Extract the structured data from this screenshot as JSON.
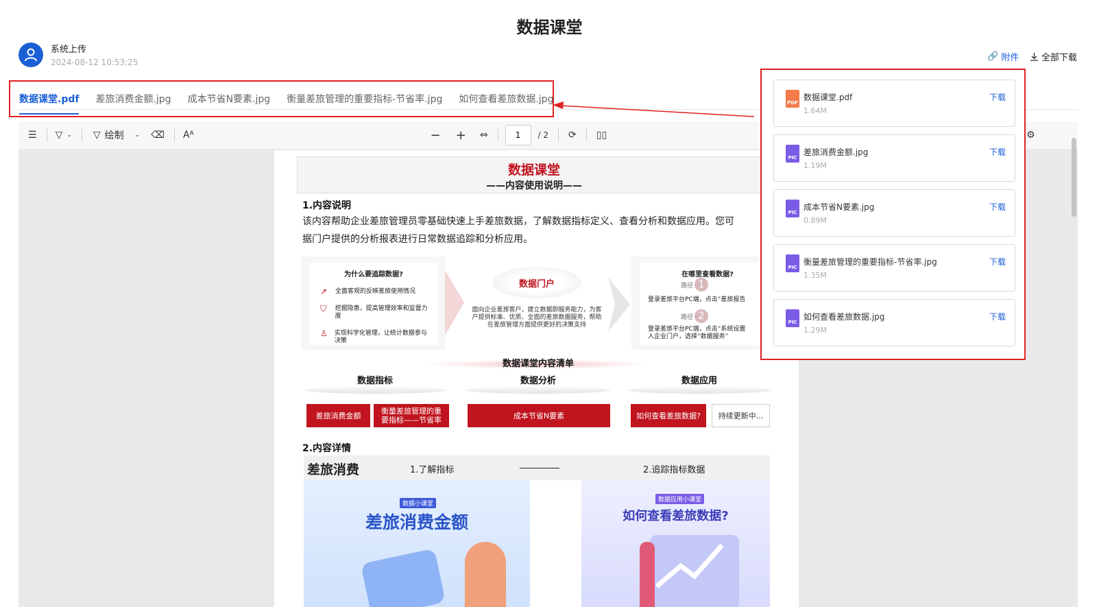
{
  "page": {
    "title": "数据课堂"
  },
  "uploader": {
    "name": "系统上传",
    "time": "2024-08-12 10:53:25"
  },
  "header_actions": {
    "attachments_label": "附件",
    "download_all_label": "全部下载"
  },
  "tabs": [
    {
      "label": "数据课堂.pdf",
      "active": true
    },
    {
      "label": "差旅消费金额.jpg",
      "active": false
    },
    {
      "label": "成本节省N要素.jpg",
      "active": false
    },
    {
      "label": "衡量差旅管理的重要指标-节省率.jpg",
      "active": false
    },
    {
      "label": "如何查看差旅数据.jpg",
      "active": false
    }
  ],
  "toolbar": {
    "draw_label": "绘制",
    "page_input": "1",
    "page_total": "/ 2"
  },
  "document": {
    "title": "数据课堂",
    "subtitle": "——内容使用说明——",
    "section1_title": "1.内容说明",
    "section1_text_1": "该内容帮助企业差旅管理员零基础快速上手差旅数据，了解数据指标定义、查看分析和数据应用。您可",
    "section1_text_2": "据门户提供的分析报表进行日常数据追踪和分析应用。",
    "left_panel": {
      "title": "为什么要追踪数据?",
      "items": [
        "全面客观的反映差旅使用情况",
        "挖掘隐患，提高管理效率和监督力度",
        "实现科学化管理，让统计数据参与决策"
      ]
    },
    "center_panel": {
      "title": "数据门户",
      "text": "面向企业差旅客户，建立数据即服务能力，为客户提供标准、优质、全面的差旅数据服务，帮助在差旅管理方面提供更好的决策支持"
    },
    "right_panel": {
      "title": "在哪里查看数据?",
      "path_label": "路径",
      "path1_num": "1",
      "path1_text": "登录差旅平台PC端，点击“差旅报告",
      "path2_num": "2",
      "path2_text": "登录差旅平台PC端，点击“系统设置入企业门户，选择“数据服务”"
    },
    "list_title": "数据课堂内容清单",
    "columns": [
      "数据指标",
      "数据分析",
      "数据应用"
    ],
    "boxes": [
      "差旅消费金额",
      "衡量差旅管理的重要指标——节省率",
      "成本节省N要素",
      "如何查看差旅数据?",
      "持续更新中..."
    ],
    "section2_title": "2.内容详情",
    "detail_bar": {
      "big": "差旅消费",
      "step1": "1.了解指标",
      "step2": "2.追踪指标数据"
    },
    "card1": {
      "badge": "数据小课堂",
      "title": "差旅消费金额"
    },
    "card2": {
      "badge": "数据应用小课堂",
      "title": "如何查看差旅数据?"
    }
  },
  "attachments": [
    {
      "name": "数据课堂.pdf",
      "size": "1.64M",
      "type": "PDF",
      "color": "#f47a4a",
      "download": "下载"
    },
    {
      "name": "差旅消费金额.jpg",
      "size": "1.19M",
      "type": "PIC",
      "color": "#7b5ce6",
      "download": "下载"
    },
    {
      "name": "成本节省N要素.jpg",
      "size": "0.89M",
      "type": "PIC",
      "color": "#7b5ce6",
      "download": "下载"
    },
    {
      "name": "衡量差旅管理的重要指标-节省率.jpg",
      "size": "1.35M",
      "type": "PIC",
      "color": "#7b5ce6",
      "download": "下载"
    },
    {
      "name": "如何查看差旅数据.jpg",
      "size": "1.29M",
      "type": "PIC",
      "color": "#7b5ce6",
      "download": "下载"
    }
  ]
}
